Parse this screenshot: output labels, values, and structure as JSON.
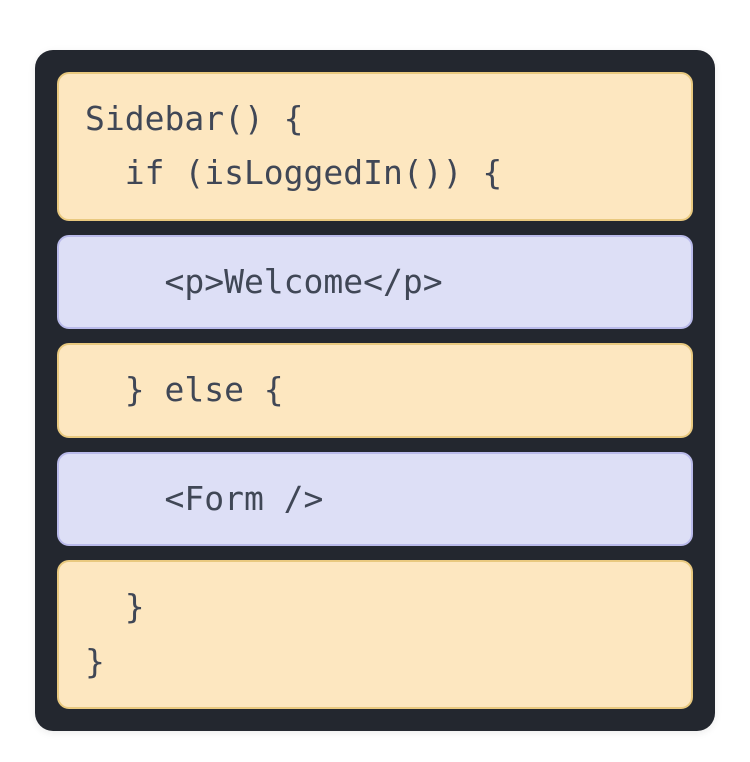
{
  "blocks": {
    "b0": {
      "line1": "Sidebar() {",
      "line2": "  if (isLoggedIn()) {"
    },
    "b1": "    <p>Welcome</p>",
    "b2": "  } else {",
    "b3": "    <Form />",
    "b4": {
      "line1": "  }",
      "line2": "}"
    }
  }
}
